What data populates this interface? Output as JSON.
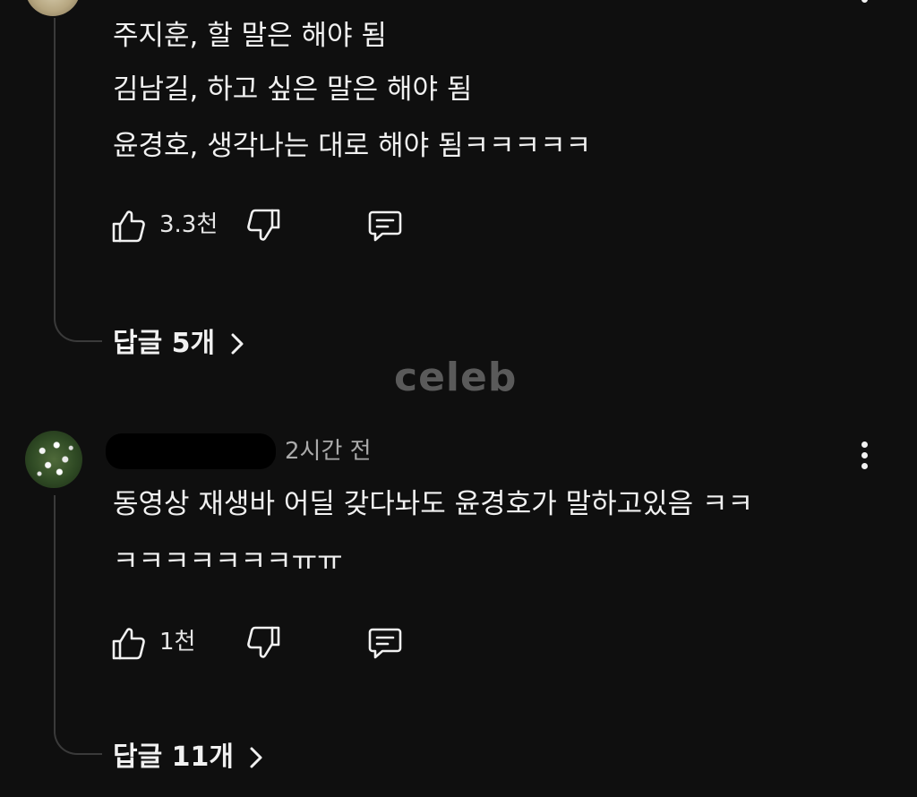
{
  "comment1": {
    "lines": [
      "주지훈, 할 말은 해야 됨",
      "김남길, 하고 싶은 말은 해야 됨",
      "윤경호, 생각나는 대로 해야 됨ㅋㅋㅋㅋㅋ"
    ],
    "like_count": "3.3천",
    "replies_label": "답글 5개"
  },
  "watermark": "celeb",
  "comment2": {
    "timestamp": "2시간 전",
    "lines": [
      "동영상 재생바 어딜 갖다놔도 윤경호가 말하고있음 ㅋㅋ",
      "ㅋㅋㅋㅋㅋㅋㅋㅠㅠ"
    ],
    "like_count": "1천",
    "replies_label": "답글 11개"
  },
  "icons": {
    "like": "thumbs-up-icon",
    "dislike": "thumbs-down-icon",
    "reply": "comment-icon",
    "more": "more-vert-icon",
    "chevron": "chevron-right-icon"
  },
  "colors": {
    "background": "#0f0f0f",
    "text": "#f1f1f1",
    "secondary_text": "#aaaaaa",
    "thread_line": "#3a3a3a",
    "watermark": "#5a5a5a"
  }
}
